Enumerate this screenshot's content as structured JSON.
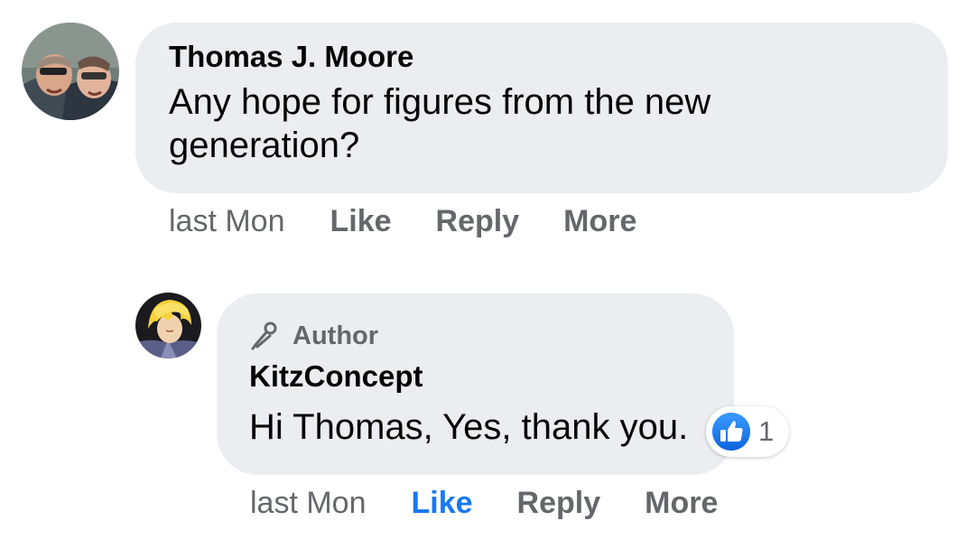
{
  "comment": {
    "author": "Thomas J. Moore",
    "text": "Any hope for figures from the new generation?",
    "timestamp": "last Mon",
    "actions": {
      "like": "Like",
      "reply": "Reply",
      "more": "More"
    },
    "avatar_icon": "user-photo-avatar"
  },
  "reply": {
    "badge": "Author",
    "badge_icon": "microphone-icon",
    "author": "KitzConcept",
    "text": "Hi Thomas, Yes, thank you.",
    "timestamp": "last Mon",
    "actions": {
      "like": "Like",
      "reply": "Reply",
      "more": "More"
    },
    "liked": true,
    "reaction": {
      "icon": "thumbs-up-icon",
      "count": "1"
    },
    "avatar_icon": "anime-character-avatar"
  },
  "colors": {
    "bubble": "#ebedf0",
    "text": "#050505",
    "secondary": "#65676b",
    "accent": "#1877f2"
  }
}
